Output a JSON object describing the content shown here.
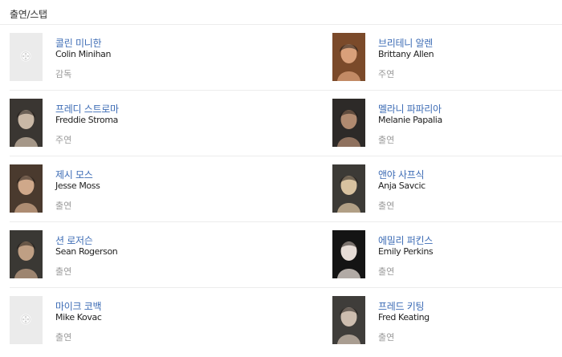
{
  "section_title": "출연/스탭",
  "cast": [
    {
      "name_ko": "콜린 미니한",
      "name_en": "Colin Minihan",
      "role": "감독",
      "photo": "none"
    },
    {
      "name_ko": "브리테니 알렌",
      "name_en": "Brittany Allen",
      "role": "주연",
      "photo": "portrait"
    },
    {
      "name_ko": "프레디 스트로마",
      "name_en": "Freddie Stroma",
      "role": "주연",
      "photo": "portrait"
    },
    {
      "name_ko": "멜라니 파파리아",
      "name_en": "Melanie Papalia",
      "role": "출연",
      "photo": "portrait"
    },
    {
      "name_ko": "제시 모스",
      "name_en": "Jesse Moss",
      "role": "출연",
      "photo": "portrait"
    },
    {
      "name_ko": "앤야 사프식",
      "name_en": "Anja Savcic",
      "role": "출연",
      "photo": "portrait"
    },
    {
      "name_ko": "션 로저슨",
      "name_en": "Sean Rogerson",
      "role": "출연",
      "photo": "portrait"
    },
    {
      "name_ko": "에밀리 퍼킨스",
      "name_en": "Emily Perkins",
      "role": "출연",
      "photo": "portrait"
    },
    {
      "name_ko": "마이크 코백",
      "name_en": "Mike Kovac",
      "role": "출연",
      "photo": "none"
    },
    {
      "name_ko": "프레드 키팅",
      "name_en": "Fred Keating",
      "role": "출연",
      "photo": "portrait"
    }
  ],
  "colors": {
    "link": "#3d6cb5",
    "role_text": "#999999",
    "divider": "#ececec",
    "placeholder_bg": "#ebebeb"
  },
  "icons": {
    "placeholder": "film-reel-icon"
  }
}
